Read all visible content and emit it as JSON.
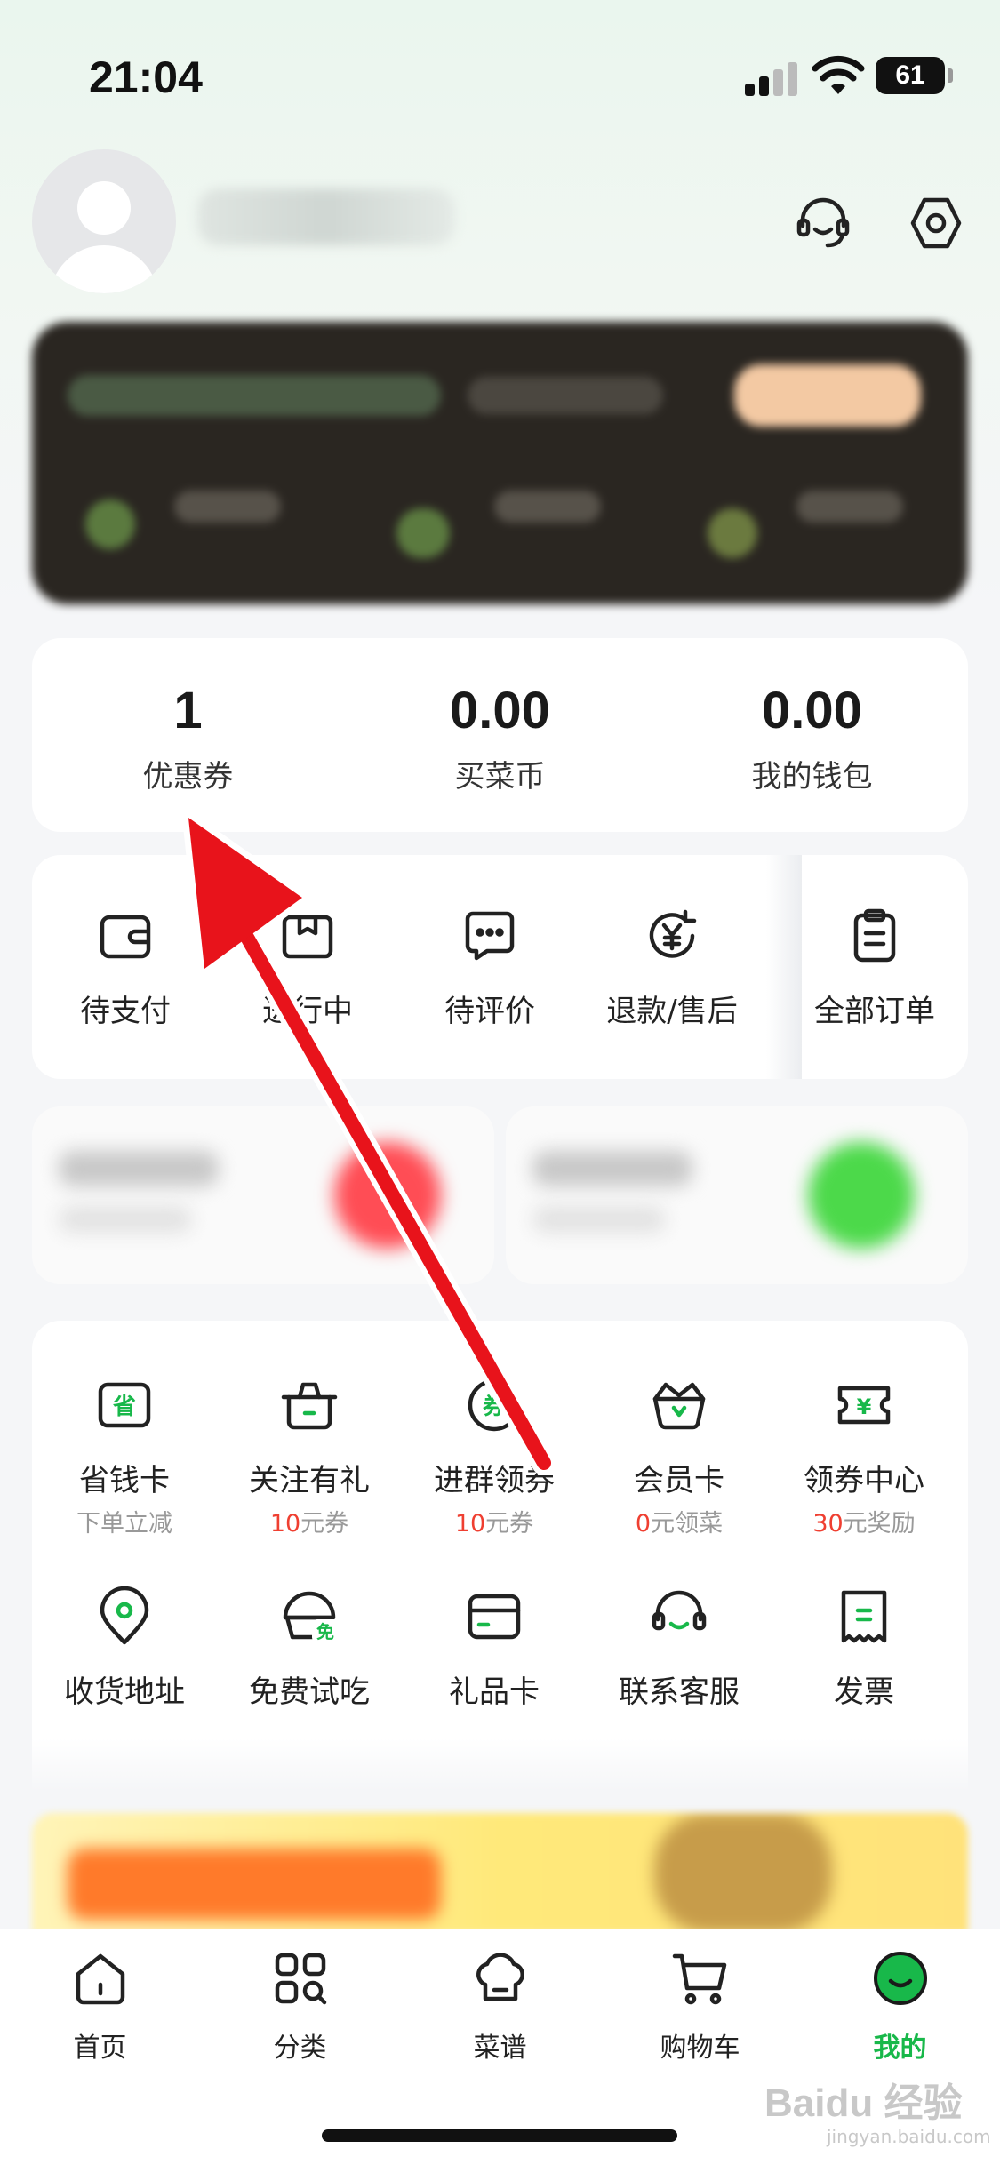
{
  "status_bar": {
    "time": "21:04",
    "battery": "61"
  },
  "assets": [
    {
      "value": "1",
      "label": "优惠券"
    },
    {
      "value": "0.00",
      "label": "买菜币"
    },
    {
      "value": "0.00",
      "label": "我的钱包"
    }
  ],
  "orders": [
    {
      "label": "待支付",
      "icon": "wallet-icon"
    },
    {
      "label": "进行中",
      "icon": "box-icon"
    },
    {
      "label": "待评价",
      "icon": "chat-icon"
    },
    {
      "label": "退款/售后",
      "icon": "refund-icon"
    },
    {
      "label": "全部订单",
      "icon": "clipboard-icon"
    }
  ],
  "services": [
    {
      "label": "省钱卡",
      "sub_plain": "下单立减",
      "icon": "save-card-icon"
    },
    {
      "label": "关注有礼",
      "sub_red": "10",
      "sub_plain": "元券",
      "icon": "gift-pot-icon"
    },
    {
      "label": "进群领券",
      "sub_red": "10",
      "sub_plain": "元券",
      "icon": "group-coupon-icon"
    },
    {
      "label": "会员卡",
      "sub_red": "0",
      "sub_plain": "元领菜",
      "icon": "crown-basket-icon"
    },
    {
      "label": "领券中心",
      "sub_red": "30",
      "sub_plain": "元奖励",
      "icon": "ticket-icon"
    },
    {
      "label": "收货地址",
      "icon": "location-icon"
    },
    {
      "label": "免费试吃",
      "icon": "free-tasting-icon"
    },
    {
      "label": "礼品卡",
      "icon": "gift-card-icon"
    },
    {
      "label": "联系客服",
      "icon": "headset-icon"
    },
    {
      "label": "发票",
      "icon": "invoice-icon"
    }
  ],
  "service_badges": {
    "free": "免",
    "coupon": "券",
    "save": "省",
    "yuan": "¥"
  },
  "tabs": [
    {
      "label": "首页",
      "icon": "home-icon"
    },
    {
      "label": "分类",
      "icon": "category-icon"
    },
    {
      "label": "菜谱",
      "icon": "chef-hat-icon"
    },
    {
      "label": "购物车",
      "icon": "cart-icon"
    },
    {
      "label": "我的",
      "icon": "my-icon",
      "active": true
    }
  ],
  "watermark": {
    "brand": "Baidu 经验",
    "domain": "jingyan.baidu.com"
  },
  "colors": {
    "accent_green": "#18b84a",
    "highlight_red": "#ef3f31",
    "arrow_red": "#e8131b"
  }
}
